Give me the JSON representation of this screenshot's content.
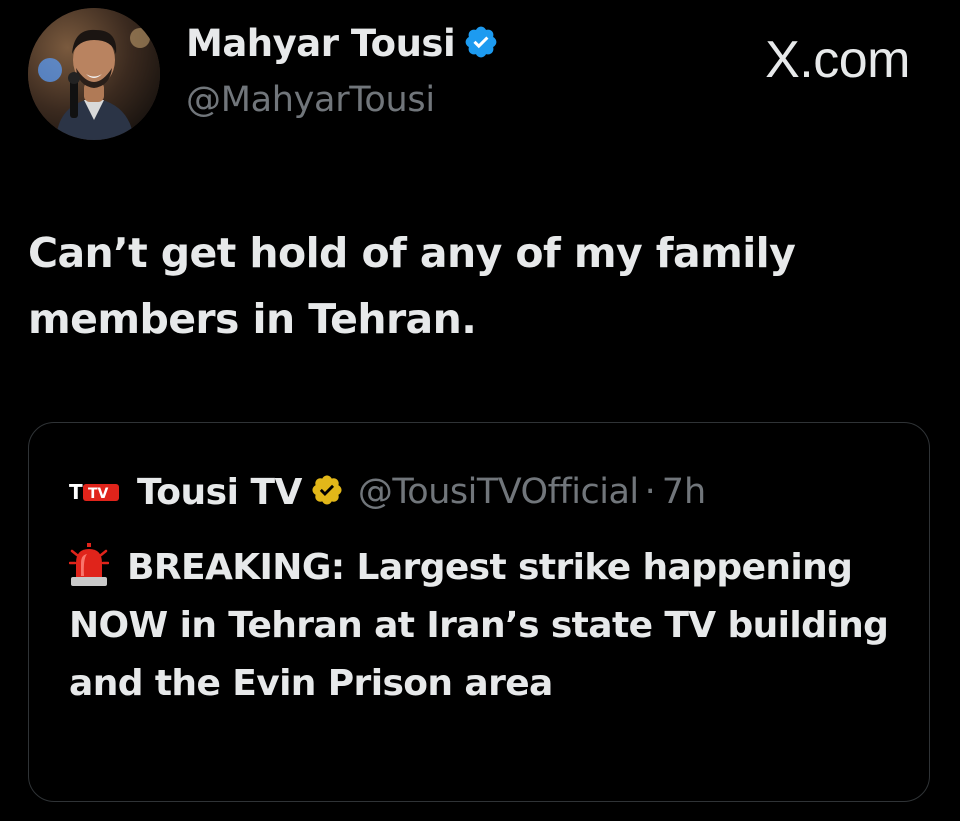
{
  "source": {
    "label": "X.com"
  },
  "author": {
    "name": "Mahyar Tousi",
    "handle": "@MahyarTousi",
    "avatar": "profile-photo",
    "verified_icon": "blue-verified-badge-icon"
  },
  "tweet": {
    "text": "Can’t get hold of any of my family members in Tehran."
  },
  "quote": {
    "logo_icon": "tousi-tv-logo-icon",
    "logo_text": "TTV",
    "name": "Tousi TV",
    "verified_icon": "gold-verified-badge-icon",
    "handle": "@TousiTVOfficial",
    "separator": "·",
    "time": "7h",
    "emoji_icon": "police-siren-icon",
    "text": "BREAKING: Largest strike happening NOW in Tehran at Iran’s state TV building and the Evin Prison area"
  },
  "colors": {
    "background": "#000000",
    "text_primary": "#e7e9ea",
    "text_secondary": "#71767b",
    "verified_blue": "#1d9bf0",
    "verified_gold": "#e2b719",
    "card_border": "#2f3336",
    "tv_logo_red": "#e0241b"
  }
}
